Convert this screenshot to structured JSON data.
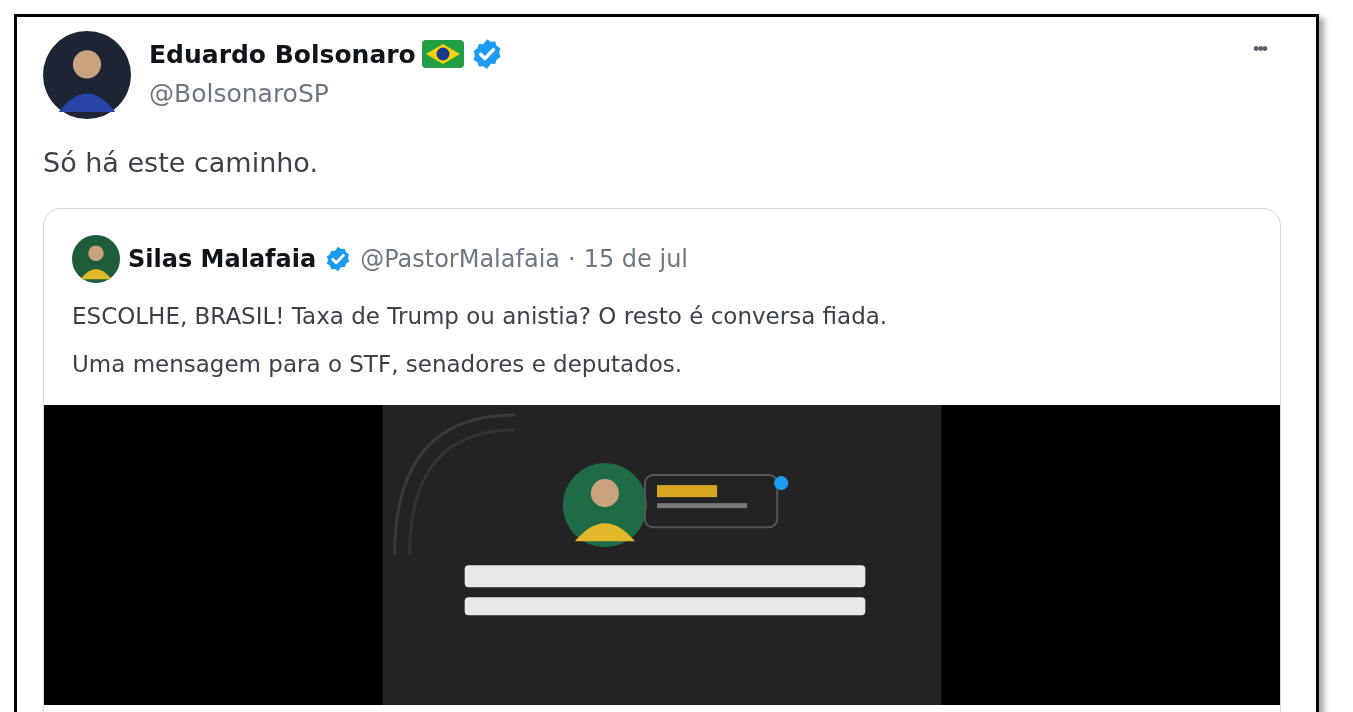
{
  "post": {
    "author": {
      "name": "Eduardo Bolsonaro",
      "handle": "@BolsonaroSP",
      "verified": true,
      "flag": true
    },
    "more_button": "•••",
    "text": "Só há este caminho.",
    "quoted_post": {
      "author": {
        "name": "Silas Malafaia",
        "handle": "@PastorMalafaia",
        "verified": true
      },
      "separator": "·",
      "date": "15 de jul",
      "paragraphs": [
        "ESCOLHE, BRASIL! Taxa de Trump ou anistia? O resto é conversa fiada.",
        "Uma mensagem para o STF, senadores e deputados."
      ]
    }
  }
}
